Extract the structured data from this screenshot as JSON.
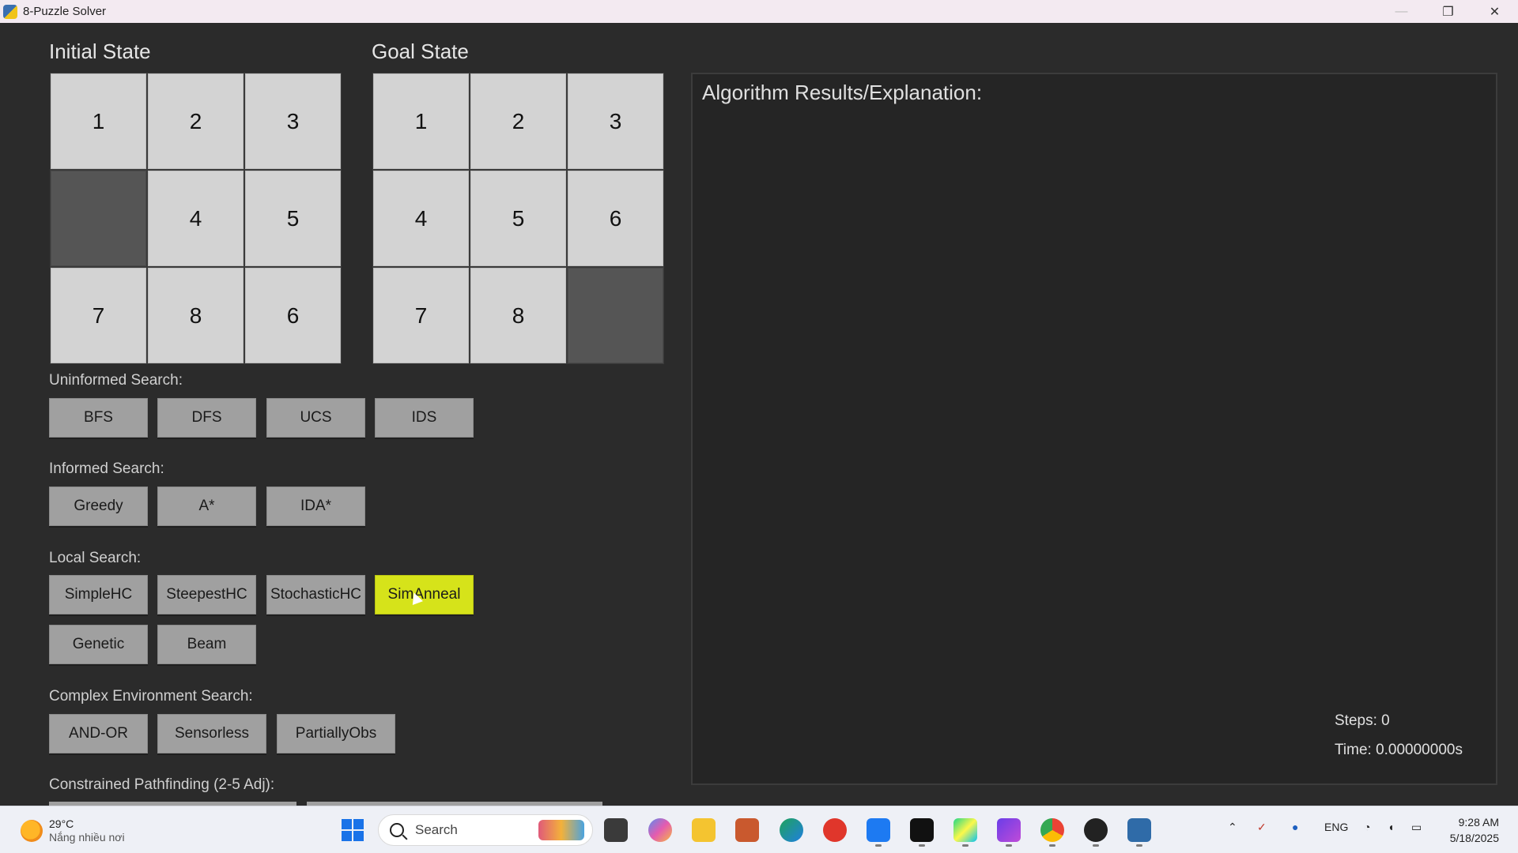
{
  "window": {
    "title": "8-Puzzle Solver",
    "minimize": "—",
    "restore": "❐",
    "close": "✕"
  },
  "initial": {
    "heading": "Initial State",
    "tiles": [
      "1",
      "2",
      "3",
      "",
      "4",
      "5",
      "7",
      "8",
      "6"
    ]
  },
  "goal": {
    "heading": "Goal State",
    "tiles": [
      "1",
      "2",
      "3",
      "4",
      "5",
      "6",
      "7",
      "8",
      ""
    ]
  },
  "uninformed": {
    "label": "Uninformed Search:",
    "buttons": [
      "BFS",
      "DFS",
      "UCS",
      "IDS"
    ]
  },
  "informed": {
    "label": "Informed Search:",
    "buttons": [
      "Greedy",
      "A*",
      "IDA*"
    ]
  },
  "local": {
    "label": "Local Search:",
    "buttons": [
      "SimpleHC",
      "SteepestHC",
      "StochasticHC",
      "SimAnneal",
      "Genetic",
      "Beam"
    ],
    "active": "SimAnneal"
  },
  "complex": {
    "label": "Complex Environment Search:",
    "buttons": [
      "AND-OR",
      "Sensorless",
      "PartiallyObs"
    ]
  },
  "constrained": {
    "label": "Constrained Pathfinding (2-5 Adj):"
  },
  "results": {
    "title": "Algorithm Results/Explanation:",
    "steps": "Steps: 0",
    "time": "Time: 0.00000000s"
  },
  "colors": {
    "accent": "#d6e31a",
    "tile": "#d3d3d3",
    "blank": "#555555",
    "panel": "#252525"
  },
  "taskbar": {
    "weather_temp": "29°C",
    "weather_cond": "Nắng nhiều nơi",
    "search_placeholder": "Search",
    "lang": "ENG",
    "time": "9:28 AM",
    "date": "5/18/2025"
  }
}
